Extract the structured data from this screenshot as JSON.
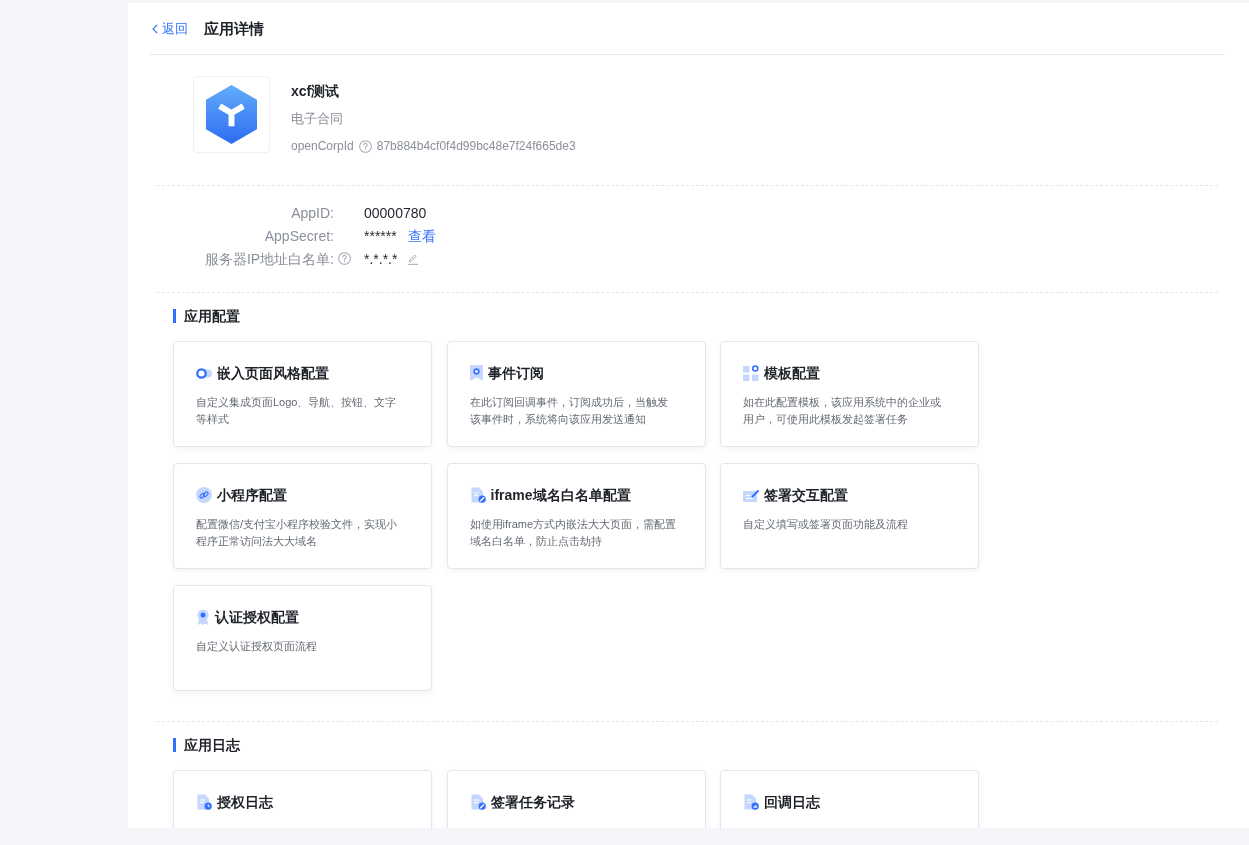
{
  "header": {
    "back_link": "返回",
    "title": "应用详情"
  },
  "app": {
    "name": "xcf测试",
    "category": "电子合同",
    "id_label": "openCorpId",
    "id_help": true,
    "id_value": "87b884b4cf0f4d99bc48e7f24f665de3"
  },
  "credentials": [
    {
      "kind": "text",
      "label": "AppID:",
      "help": false,
      "value": "00000780"
    },
    {
      "kind": "secret",
      "label": "AppSecret:",
      "help": false,
      "value": "******",
      "link": "查看"
    },
    {
      "kind": "editable",
      "label": "服务器IP地址白名单:",
      "help": true,
      "value": "*.*.*.*"
    }
  ],
  "sections": [
    {
      "title": "应用配置",
      "cards": [
        {
          "title": "嵌入页面风格配置",
          "description": "自定义集成页面Logo、导航、按钮、文字等样式"
        },
        {
          "title": "事件订阅",
          "description": "在此订阅回调事件，订阅成功后，当触发该事件时，系统将向该应用发送通知"
        },
        {
          "title": "模板配置",
          "description": "如在此配置模板，该应用系统中的企业或用户，可使用此模板发起签署任务"
        },
        {
          "title": "小程序配置",
          "description": "配置微信/支付宝小程序校验文件，实现小程序正常访问法大大域名"
        },
        {
          "title": "iframe域名白名单配置",
          "description": "如使用iframe方式内嵌法大大页面，需配置域名白名单，防止点击劫持"
        },
        {
          "title": "签署交互配置",
          "description": "自定义填写或签署页面功能及流程"
        },
        {
          "title": "认证授权配置",
          "description": "自定义认证授权页面流程"
        }
      ]
    },
    {
      "title": "应用日志",
      "cards": [
        {
          "title": "授权日志"
        },
        {
          "title": "签署任务记录"
        },
        {
          "title": "回调日志"
        }
      ]
    }
  ]
}
